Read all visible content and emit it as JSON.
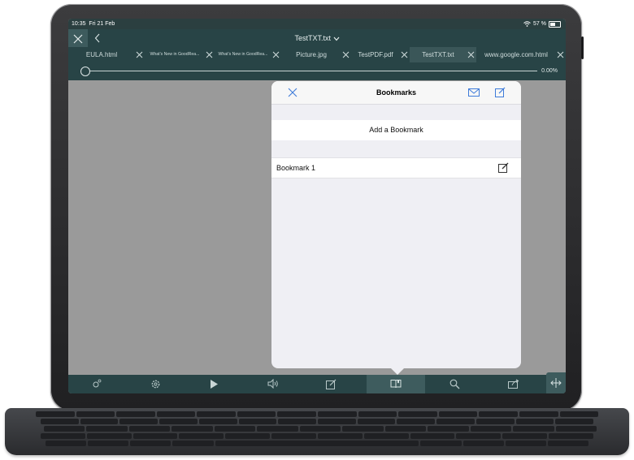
{
  "status": {
    "time": "10:35",
    "date": "Fri 21 Feb",
    "battery": "57 %"
  },
  "titlebar": {
    "title": "TestTXT.txt"
  },
  "tabs": [
    {
      "label": "EULA.html",
      "small": false,
      "active": false
    },
    {
      "label": "What's New in GoodRea...",
      "small": true,
      "active": false
    },
    {
      "label": "What's New in GoodRea...",
      "small": true,
      "active": false
    },
    {
      "label": "Picture.jpg",
      "small": false,
      "active": false
    },
    {
      "label": "TestPDF.pdf",
      "small": false,
      "active": false
    },
    {
      "label": "TestTXT.txt",
      "small": false,
      "active": true
    },
    {
      "label": "www.google.com.html",
      "small": false,
      "active": false
    }
  ],
  "progress": {
    "percent_label": "0.00%",
    "value": 0
  },
  "bookmarks_popover": {
    "title": "Bookmarks",
    "add_label": "Add a Bookmark",
    "items": [
      {
        "label": "Bookmark 1"
      }
    ]
  },
  "toolbar": {
    "items": [
      "settings-gear-small",
      "settings-gear",
      "play",
      "speaker",
      "edit",
      "bookmarks",
      "search",
      "share"
    ],
    "active_index": 5
  },
  "colors": {
    "bar": "#284446",
    "accent": "#3e7bd9",
    "popover_bg": "#efeff4"
  }
}
